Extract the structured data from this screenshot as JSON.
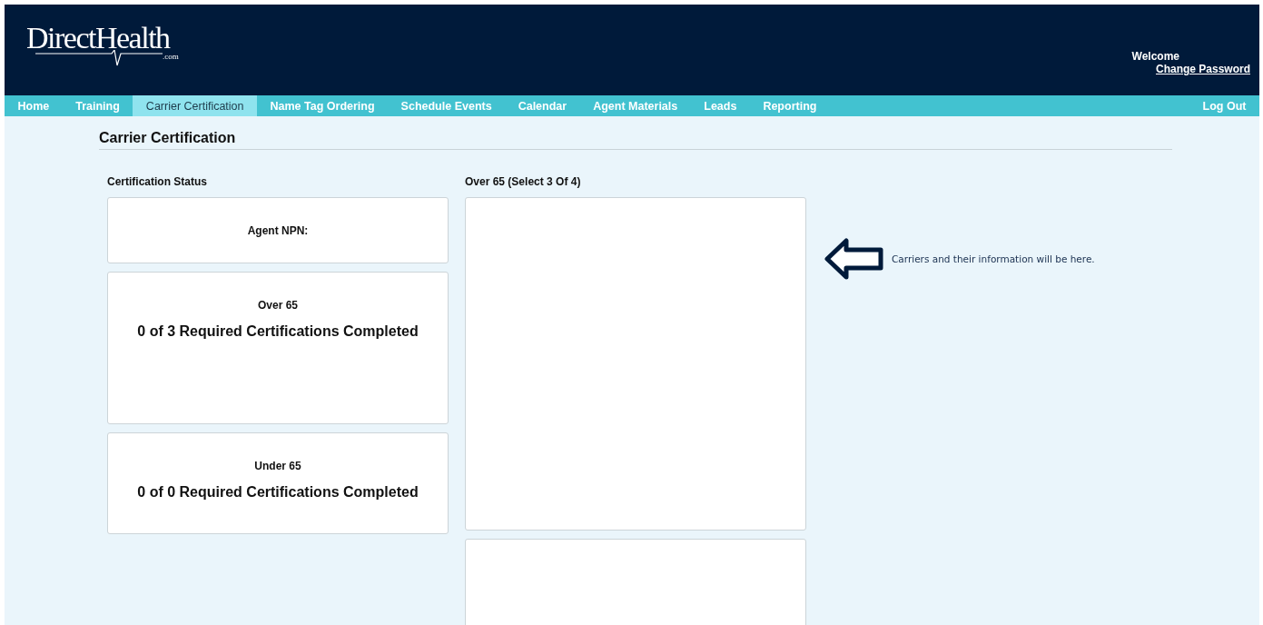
{
  "logo": {
    "name": "DirectHealth",
    "suffix": ".com"
  },
  "user_menu": {
    "greeting": "Welcome",
    "link": "Change Password"
  },
  "nav": {
    "items": [
      {
        "label": "Home",
        "selected": false
      },
      {
        "label": "Training",
        "selected": false
      },
      {
        "label": "Carrier Certification",
        "selected": true
      },
      {
        "label": "Name Tag Ordering",
        "selected": false
      },
      {
        "label": "Schedule Events",
        "selected": false
      },
      {
        "label": "Calendar",
        "selected": false
      },
      {
        "label": "Agent Materials",
        "selected": false
      },
      {
        "label": "Leads",
        "selected": false
      },
      {
        "label": "Reporting",
        "selected": false
      }
    ],
    "logout": "Log Out"
  },
  "page_title": "Carrier Certification",
  "status": {
    "heading": "Certification Status",
    "npn_label": "Agent NPN:",
    "groups": [
      {
        "name": "Over 65",
        "summary": "0 of 3 Required Certifications Completed"
      },
      {
        "name": "Under 65",
        "summary": "0 of 0 Required Certifications Completed"
      }
    ]
  },
  "carriers": {
    "heading": "Over 65 (Select 3 Of 4)",
    "hint": "Carriers and their information will be here."
  }
}
